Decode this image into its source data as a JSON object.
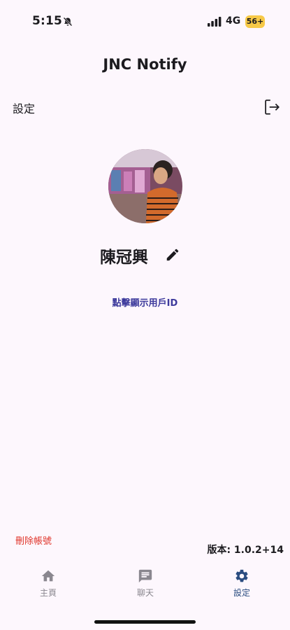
{
  "status_bar": {
    "time": "5:15",
    "network": "4G",
    "battery": "56+"
  },
  "header": {
    "app_title": "JNC Notify",
    "section_title": "設定"
  },
  "profile": {
    "name": "陳冠興",
    "show_id_link": "點擊顯示用戶ID"
  },
  "footer": {
    "delete_account": "刪除帳號",
    "version": "版本: 1.0.2+14"
  },
  "bottom_nav": {
    "items": [
      {
        "label": "主頁",
        "icon": "home-icon",
        "active": false
      },
      {
        "label": "聊天",
        "icon": "chat-icon",
        "active": false
      },
      {
        "label": "設定",
        "icon": "gear-icon",
        "active": true
      }
    ]
  },
  "colors": {
    "background": "#fdf7fd",
    "accent": "#2a4c80",
    "danger": "#e0352b",
    "link": "#3d3a9c",
    "inactive": "#8a878f"
  }
}
